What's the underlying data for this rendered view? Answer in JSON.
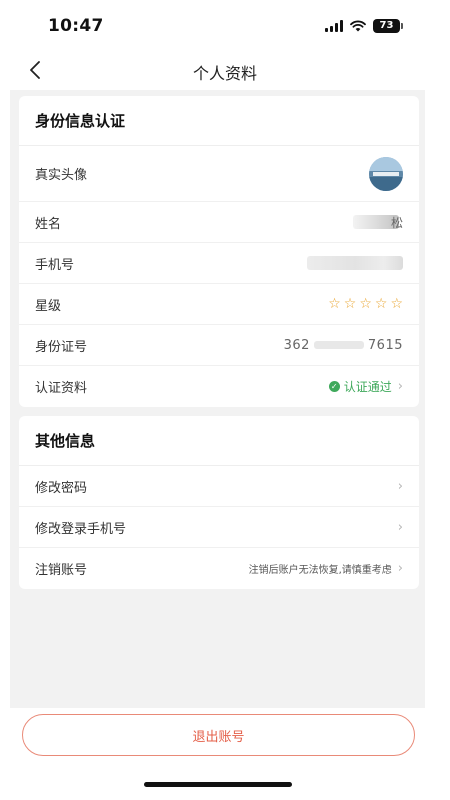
{
  "status_bar": {
    "time": "10:47",
    "battery": "73"
  },
  "nav": {
    "title": "个人资料"
  },
  "identity": {
    "title": "身份信息认证",
    "avatar_label": "真实头像",
    "name_label": "姓名",
    "name_value": "松",
    "phone_label": "手机号",
    "star_label": "星级",
    "stars": [
      "☆",
      "☆",
      "☆",
      "☆",
      "☆"
    ],
    "id_label": "身份证号",
    "id_prefix": "362",
    "id_suffix": "7615",
    "cert_label": "认证资料",
    "cert_status": "认证通过"
  },
  "other": {
    "title": "其他信息",
    "change_password": "修改密码",
    "change_phone": "修改登录手机号",
    "cancel_account": "注销账号",
    "cancel_hint": "注销后账户无法恢复,请慎重考虑"
  },
  "logout_label": "退出账号",
  "colors": {
    "accent_red": "#e4604a",
    "success_green": "#3fa95b",
    "star_orange": "#e9a530"
  },
  "icons": {
    "back": "chevron-left-icon",
    "chevron": "chevron-right-icon",
    "check": "check-circle-icon",
    "wifi": "wifi-icon",
    "signal": "signal-icon",
    "battery": "battery-icon"
  }
}
